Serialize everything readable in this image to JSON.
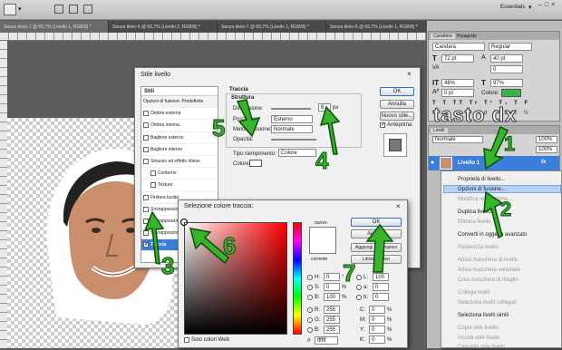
{
  "app": {
    "workspace_label": "Essentials",
    "tabs": [
      "Senza titolo-1 @ 66,7% (Livello 1, RGB/8) *",
      "Senza titolo-6 @ 66,7% (Livello 2, RGB/8) *",
      "Senza titolo-7 @ 66,7% (Livello 1, RGB/8) *",
      "Senza titolo-8 @ 66,7% (Livello 1, RGB/8) *"
    ]
  },
  "char_panel": {
    "tab_character": "Carattere",
    "tab_paragraph": "Paragrafo",
    "font_family": "Candara",
    "font_style": "Regular",
    "size": "72 pt",
    "leading": "40 pt",
    "tracking": "0",
    "scale_v": "48%",
    "scale_h": "97%",
    "baseline": "0 pt",
    "color_label": "Colore:"
  },
  "layers_panel": {
    "tab": "Livelli",
    "blend_mode": "Normale",
    "opacity": "100%",
    "fill": "100%",
    "layer_name": "Livello 1",
    "fx": "fx"
  },
  "context_menu": {
    "items": [
      "Proprietà di livello...",
      "Opzioni di fusione...",
      "Modifica regolazione...",
      "Duplica livello...",
      "Elimina livello",
      "Converti in oggetto avanzato",
      "Rasterizza livello",
      "Attiva maschera di livello",
      "Attiva maschera vettoriale",
      "Crea maschera di ritaglio",
      "Collega livelli",
      "Seleziona livelli collegati",
      "Seleziona livelli simili",
      "Copia stile livello",
      "Incolla stile livello",
      "Cancella stile livello"
    ]
  },
  "layer_style": {
    "title": "Stile livello",
    "styles_header": "Stili",
    "items": [
      {
        "label": "Opzioni di fusione: Predefinite",
        "check": false,
        "indent": false
      },
      {
        "label": "Ombra esterna",
        "check": true,
        "indent": false
      },
      {
        "label": "Ombra interna",
        "check": true,
        "indent": false
      },
      {
        "label": "Bagliore esterno",
        "check": true,
        "indent": false
      },
      {
        "label": "Bagliore interno",
        "check": true,
        "indent": false
      },
      {
        "label": "Smusso ed effetto rilievo",
        "check": true,
        "indent": false
      },
      {
        "label": "Contorno",
        "check": true,
        "indent": true
      },
      {
        "label": "Texture",
        "check": true,
        "indent": true
      },
      {
        "label": "Finitura lucida",
        "check": true,
        "indent": false
      },
      {
        "label": "Sovrapposizione colore",
        "check": true,
        "indent": false
      },
      {
        "label": "Sovrapposizione sfumatura",
        "check": true,
        "indent": false
      },
      {
        "label": "Sovrapposizione pattern",
        "check": true,
        "indent": false
      },
      {
        "label": "Traccia",
        "check": true,
        "indent": false
      }
    ],
    "section_title": "Traccia",
    "structure_title": "Struttura",
    "size_label": "Dimensione:",
    "size_value": "8",
    "size_unit": "px",
    "position_label": "Posizione:",
    "position_value": "Esterno",
    "blend_label": "Metodo fusione:",
    "blend_value": "Normale",
    "opacity_label": "Opacità:",
    "fill_type_label": "Tipo riempimento:",
    "fill_type_value": "Colore",
    "color_label": "Colore:",
    "ok": "OK",
    "cancel": "Annulla",
    "new_style": "Nuovo stile...",
    "preview": "Anteprima"
  },
  "color_picker": {
    "title": "Selezione colore traccia:",
    "ok": "OK",
    "cancel": "Annulla",
    "add_swatches": "Aggiungi ai campioni",
    "libraries": "Librerie colori",
    "new_label": "nuovo",
    "current_label": "corrente",
    "web_only": "Solo colori Web",
    "hex": "ffffff",
    "hsb": [
      {
        "k": "H:",
        "v": "0",
        "u": "°"
      },
      {
        "k": "S:",
        "v": "0",
        "u": "%"
      },
      {
        "k": "B:",
        "v": "100",
        "u": "%"
      }
    ],
    "rgb": [
      {
        "k": "R:",
        "v": "255"
      },
      {
        "k": "G:",
        "v": "255"
      },
      {
        "k": "B:",
        "v": "255"
      }
    ],
    "lab": [
      {
        "k": "L:",
        "v": "100"
      },
      {
        "k": "a:",
        "v": "0"
      },
      {
        "k": "b:",
        "v": "0"
      }
    ],
    "cmyk": [
      {
        "k": "C:",
        "v": "0",
        "u": "%"
      },
      {
        "k": "M:",
        "v": "0",
        "u": "%"
      },
      {
        "k": "Y:",
        "v": "0",
        "u": "%"
      },
      {
        "k": "K:",
        "v": "0",
        "u": "%"
      }
    ]
  },
  "annotations": {
    "text": "tasto dx",
    "numbers": [
      "1",
      "2",
      "3",
      "4",
      "5",
      "6",
      "7"
    ]
  }
}
